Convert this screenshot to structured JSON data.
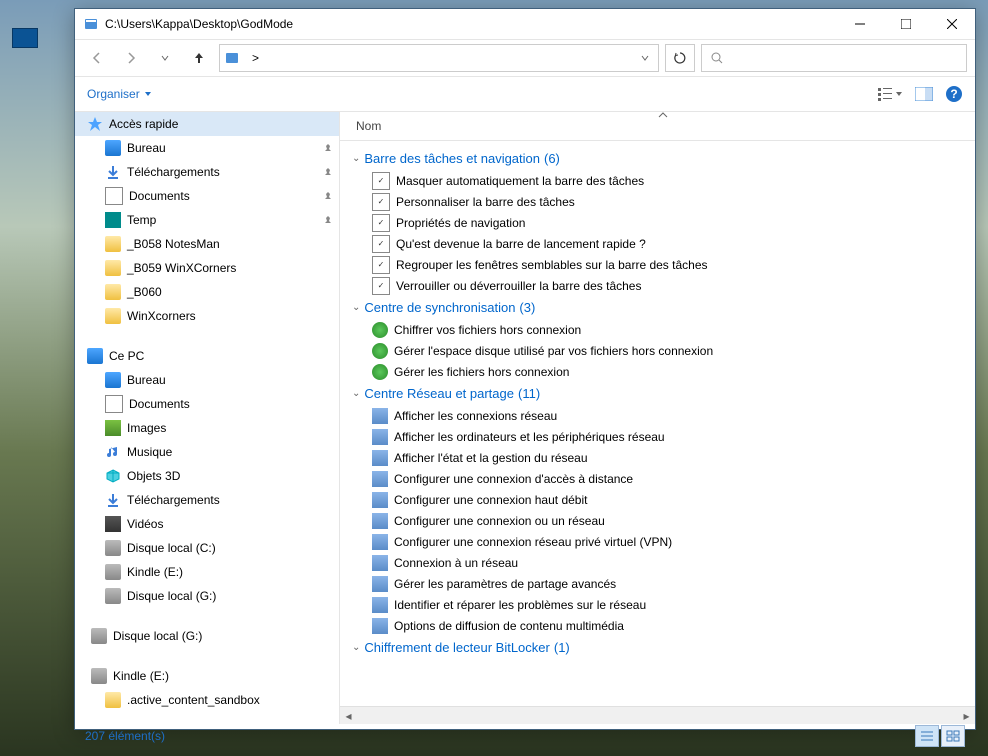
{
  "window": {
    "title": "C:\\Users\\Kappa\\Desktop\\GodMode",
    "path_segment": ">",
    "search_placeholder": ""
  },
  "toolbar": {
    "organiser": "Organiser"
  },
  "column": {
    "name": "Nom"
  },
  "sidebar": {
    "quick_access": "Accès rapide",
    "items1": [
      {
        "label": "Bureau",
        "icon": "monitor",
        "pin": true
      },
      {
        "label": "Téléchargements",
        "icon": "download",
        "pin": true
      },
      {
        "label": "Documents",
        "icon": "doc",
        "pin": true
      },
      {
        "label": "Temp",
        "icon": "teal",
        "pin": true
      },
      {
        "label": "_B058 NotesMan",
        "icon": "folder",
        "pin": false
      },
      {
        "label": "_B059 WinXCorners",
        "icon": "folder",
        "pin": false
      },
      {
        "label": "_B060",
        "icon": "folder",
        "pin": false
      },
      {
        "label": "WinXcorners",
        "icon": "folder",
        "pin": false
      }
    ],
    "this_pc": "Ce PC",
    "items2": [
      {
        "label": "Bureau",
        "icon": "monitor"
      },
      {
        "label": "Documents",
        "icon": "doc"
      },
      {
        "label": "Images",
        "icon": "img"
      },
      {
        "label": "Musique",
        "icon": "music"
      },
      {
        "label": "Objets 3D",
        "icon": "cube"
      },
      {
        "label": "Téléchargements",
        "icon": "download"
      },
      {
        "label": "Vidéos",
        "icon": "film"
      },
      {
        "label": "Disque local (C:)",
        "icon": "drive"
      },
      {
        "label": "Kindle (E:)",
        "icon": "drive"
      },
      {
        "label": "Disque local (G:)",
        "icon": "drive"
      }
    ],
    "extra": [
      {
        "label": "Disque local (G:)",
        "icon": "drive"
      },
      {
        "label": "Kindle (E:)",
        "icon": "drive"
      }
    ],
    "extra_sub": {
      "label": ".active_content_sandbox",
      "icon": "folder"
    }
  },
  "groups": [
    {
      "title": "Barre des tâches et navigation",
      "count": "(6)",
      "icon": "check",
      "items": [
        "Masquer automatiquement la barre des tâches",
        "Personnaliser la barre des tâches",
        "Propriétés de navigation",
        "Qu'est devenue la barre de lancement rapide ?",
        "Regrouper les fenêtres semblables sur la barre des tâches",
        "Verrouiller ou déverrouiller la barre des tâches"
      ]
    },
    {
      "title": "Centre de synchronisation",
      "count": "(3)",
      "icon": "green",
      "items": [
        "Chiffrer vos fichiers hors connexion",
        "Gérer l'espace disque utilisé par vos fichiers hors connexion",
        "Gérer les fichiers hors connexion"
      ]
    },
    {
      "title": "Centre Réseau et partage",
      "count": "(11)",
      "icon": "net",
      "items": [
        "Afficher les connexions réseau",
        "Afficher les ordinateurs et les périphériques réseau",
        "Afficher l'état et la gestion du réseau",
        "Configurer une connexion d'accès à distance",
        "Configurer une connexion haut débit",
        "Configurer une connexion ou un réseau",
        "Configurer une connexion réseau privé virtuel (VPN)",
        "Connexion à un réseau",
        "Gérer les paramètres de partage avancés",
        "Identifier et réparer les problèmes sur le réseau",
        "Options de diffusion de contenu multimédia"
      ]
    },
    {
      "title": "Chiffrement de lecteur BitLocker",
      "count": "(1)",
      "icon": "net",
      "items": []
    }
  ],
  "status": {
    "text": "207 élément(s)"
  }
}
